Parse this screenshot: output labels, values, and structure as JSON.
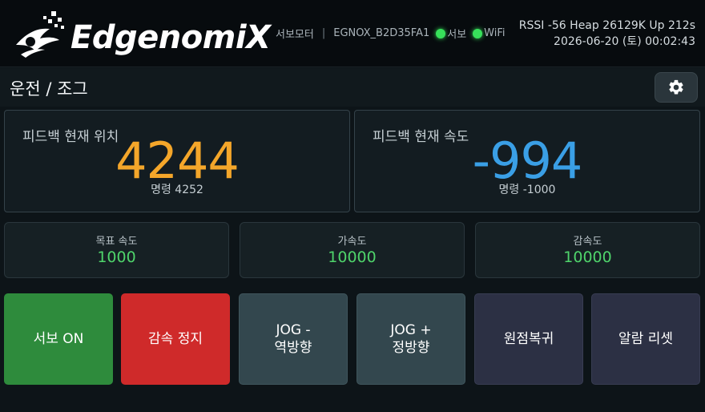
{
  "header": {
    "brand": "EdgenomiX",
    "mode": "서보모터",
    "separator": "|",
    "device_id": "EGNOX_B2D35FA1",
    "servo_indicator": "서보",
    "wifi_indicator": "WiFi",
    "indicator_color": "#37e05a",
    "stats_line": "RSSI -56  Heap 26129K  Up 212s",
    "datetime": "2026-06-20 (토) 00:02:43"
  },
  "titlebar": {
    "title": "운전 / 조그",
    "settings_icon": "gear-icon"
  },
  "feedback": {
    "position": {
      "label": "피드백 현재 위치",
      "value": "4244",
      "command": "명령 4252",
      "color": "#f4a62a"
    },
    "velocity": {
      "label": "피드백 현재 속도",
      "value": "-994",
      "command": "명령 -1000",
      "color": "#3a9fe6"
    }
  },
  "settings": [
    {
      "label": "목표 속도",
      "value": "1000"
    },
    {
      "label": "가속도",
      "value": "10000"
    },
    {
      "label": "감속도",
      "value": "10000"
    }
  ],
  "actions": {
    "servo_on": "서보 ON",
    "decel_stop": "감속 정지",
    "jog_minus_line1": "JOG -",
    "jog_minus_line2": "역방향",
    "jog_plus_line1": "JOG +",
    "jog_plus_line2": "정방향",
    "homing": "원점복귀",
    "alarm_reset": "알람 리셋"
  },
  "colors": {
    "servo_on": "#2e8b3c",
    "decel_stop": "#cf2a2a",
    "jog": "#33474e",
    "utility": "#2c3044",
    "setting_value": "#4fd46b"
  }
}
